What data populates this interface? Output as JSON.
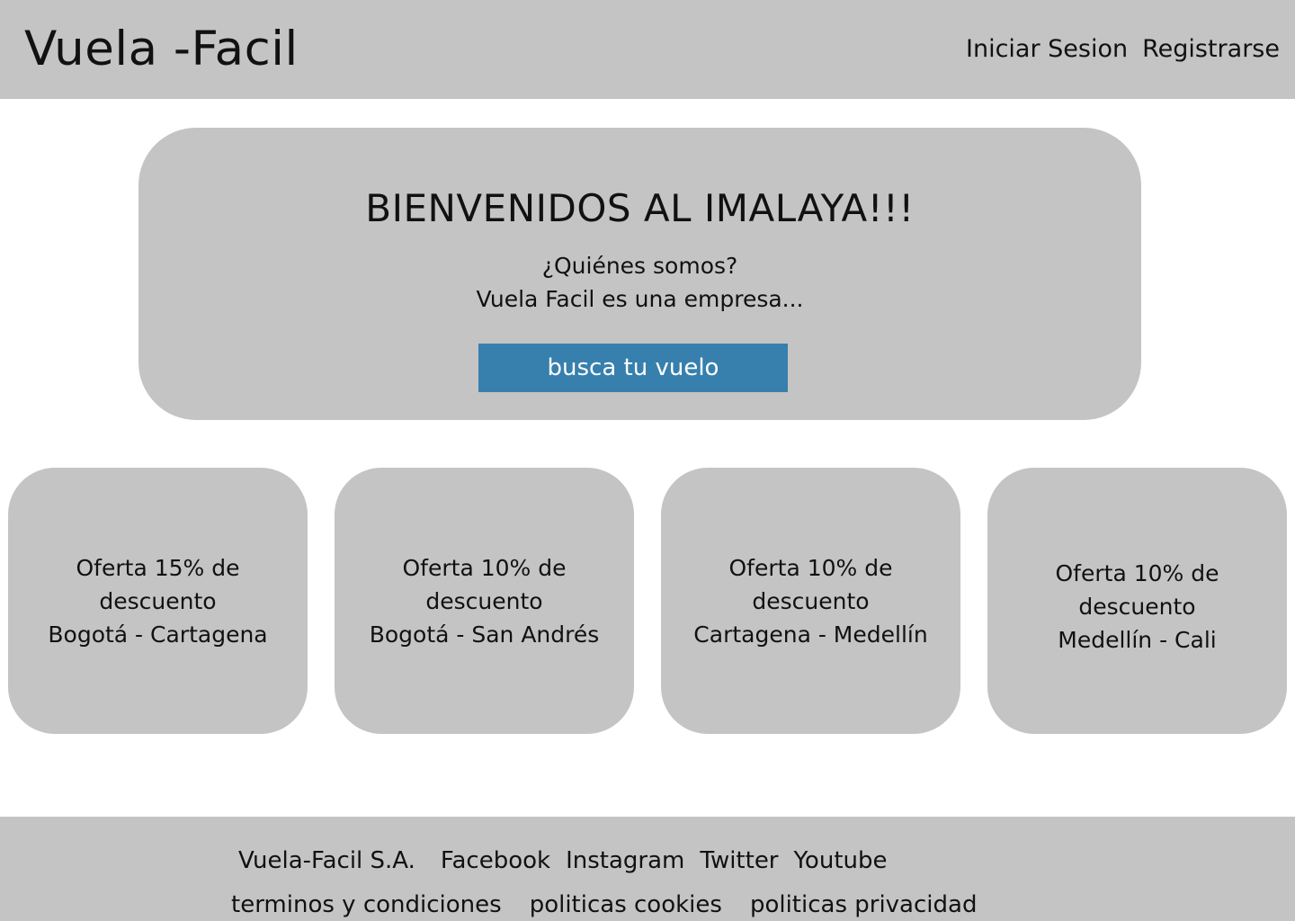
{
  "header": {
    "brand": "Vuela -Facil",
    "nav": [
      {
        "label": "Iniciar Sesion"
      },
      {
        "label": "Registrarse"
      }
    ]
  },
  "hero": {
    "title": "BIENVENIDOS AL IMALAYA!!!",
    "subtitle_line1": "¿Quiénes somos?",
    "subtitle_line2": "Vuela Facil es una empresa...",
    "cta_label": "busca tu vuelo"
  },
  "offers": [
    {
      "line1": "Oferta 15% de",
      "line2": "descuento",
      "route": "Bogotá - Cartagena"
    },
    {
      "line1": "Oferta 10% de",
      "line2": "descuento",
      "route": "Bogotá - San Andrés"
    },
    {
      "line1": "Oferta 10% de",
      "line2": "descuento",
      "route": "Cartagena - Medellín"
    },
    {
      "line1": "Oferta 10% de",
      "line2": "descuento",
      "route": "Medellín - Cali"
    }
  ],
  "footer": {
    "company": "Vuela-Facil S.A.",
    "social": [
      "Facebook",
      "Instagram",
      "Twitter",
      "Youtube"
    ],
    "legal": [
      "terminos y condiciones",
      "politicas cookies",
      "politicas privacidad"
    ]
  },
  "colors": {
    "panel_gray": "#c4c4c4",
    "button_blue": "#3780ad",
    "text": "#111111"
  }
}
